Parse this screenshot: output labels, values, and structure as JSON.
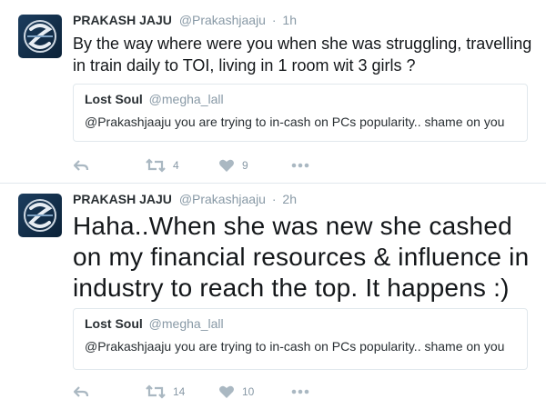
{
  "colors": {
    "text": "#14171a",
    "muted": "#8899a6",
    "border": "#e1e8ed",
    "icon": "#aab8c2",
    "avatar": "#1c3d5e"
  },
  "tweets": [
    {
      "name": "PRAKASH JAJU",
      "handle": "@Prakashjaaju",
      "time": "1h",
      "text": "By the way where were you when she was struggling, travelling in train daily to TOI, living in 1 room wit 3 girls ?",
      "quote": {
        "name": "Lost Soul",
        "handle": "@megha_lall",
        "text": "@Prakashjaaju you are trying to in-cash on PCs popularity.. shame on you"
      },
      "retweets": "4",
      "likes": "9",
      "icons": [
        "reply-icon",
        "retweet-icon",
        "heart-icon",
        "more-icon"
      ]
    },
    {
      "name": "PRAKASH JAJU",
      "handle": "@Prakashjaaju",
      "time": "2h",
      "text": "Haha..When she was new she cashed on my financial resources & influence in industry to reach the top. It happens :)",
      "quote": {
        "name": "Lost Soul",
        "handle": "@megha_lall",
        "text": "@Prakashjaaju you are trying to in-cash on PCs popularity.. shame on you"
      },
      "retweets": "14",
      "likes": "10",
      "icons": [
        "reply-icon",
        "retweet-icon",
        "heart-icon",
        "more-icon"
      ]
    }
  ],
  "separator": "·"
}
